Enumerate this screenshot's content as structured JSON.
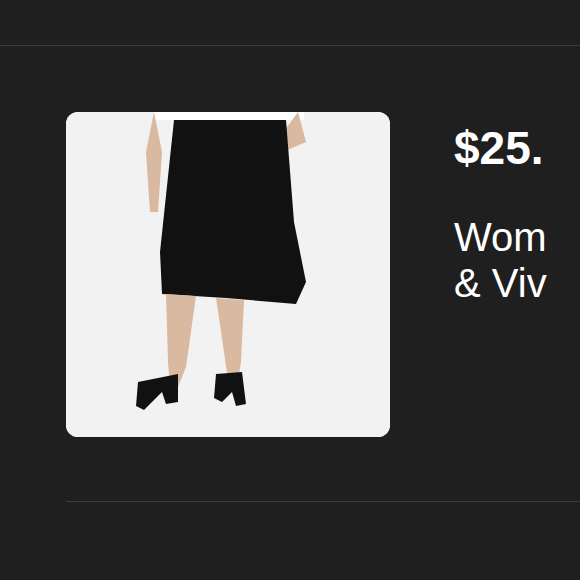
{
  "product": {
    "price": "$25.",
    "title_lines": [
      "Wom",
      "& Viv"
    ]
  }
}
